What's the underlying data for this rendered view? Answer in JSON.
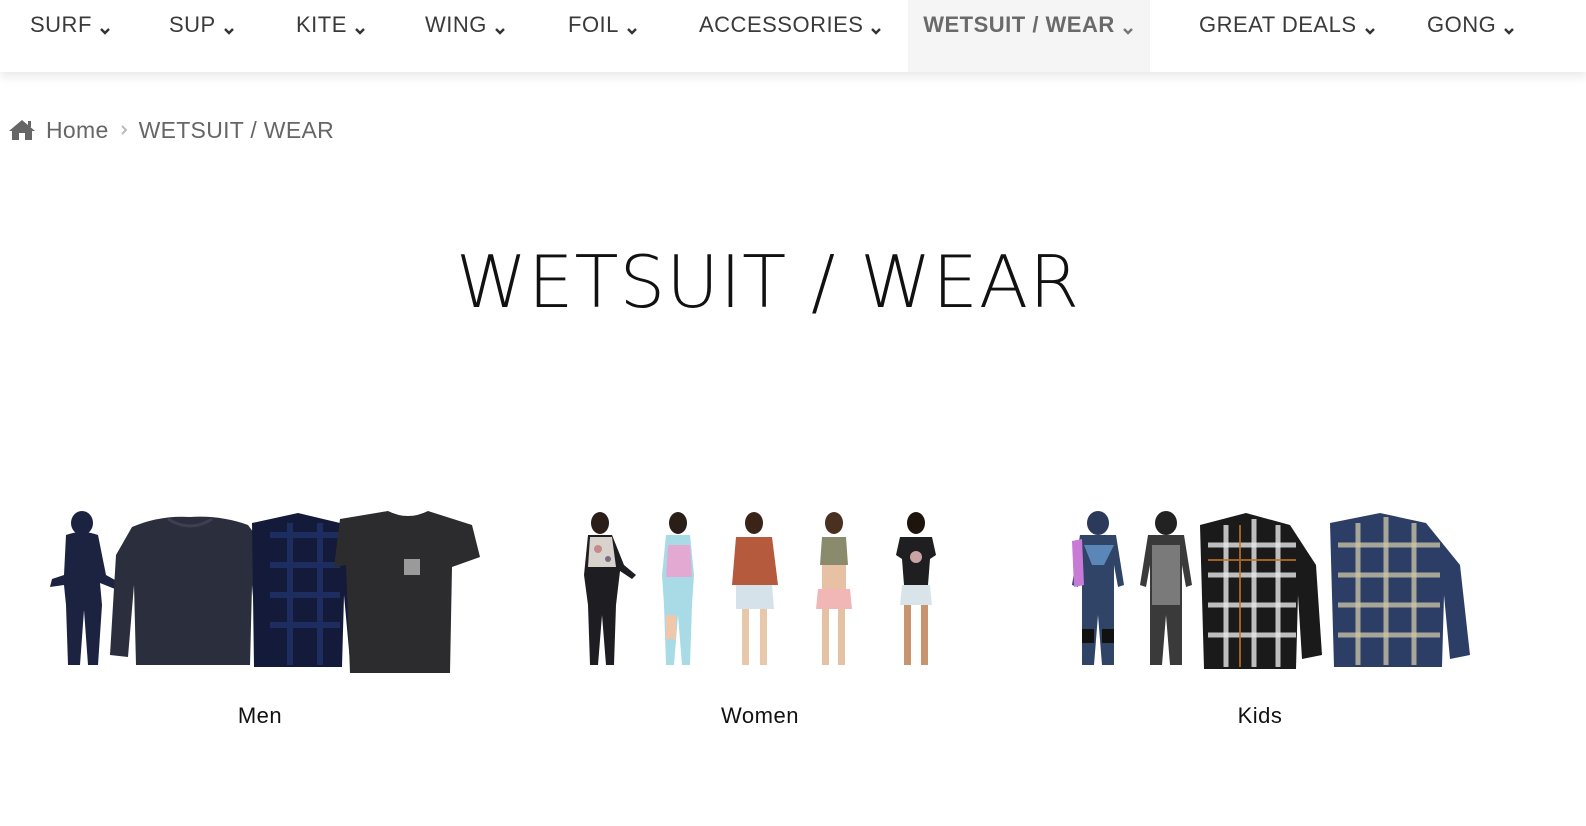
{
  "nav": {
    "items": [
      {
        "label": "SURF"
      },
      {
        "label": "SUP"
      },
      {
        "label": "KITE"
      },
      {
        "label": "WING"
      },
      {
        "label": "FOIL"
      },
      {
        "label": "ACCESSORIES"
      },
      {
        "label": "WETSUIT / WEAR",
        "active": true
      },
      {
        "label": "GREAT DEALS"
      },
      {
        "label": "GONG"
      }
    ]
  },
  "breadcrumb": {
    "home": "Home",
    "current": "WETSUIT / WEAR"
  },
  "page": {
    "title": "WETSUIT / WEAR"
  },
  "categories": [
    {
      "label": "Men"
    },
    {
      "label": "Women"
    },
    {
      "label": "Kids"
    }
  ],
  "colors": {
    "nav_text": "#3a3a3a",
    "nav_active_bg": "#f5f5f5",
    "nav_active_text": "#6a6a6a",
    "breadcrumb_text": "#666666"
  }
}
